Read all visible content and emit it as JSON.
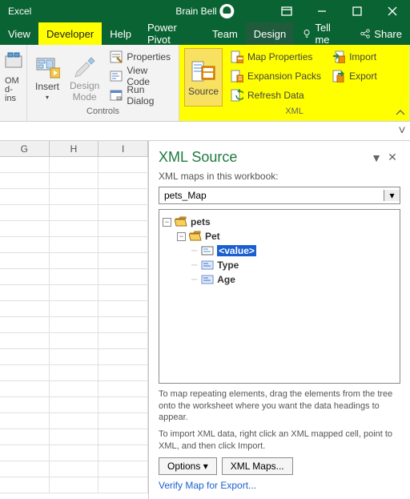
{
  "titlebar": {
    "app_name": "Excel",
    "user_name": "Brain Bell"
  },
  "tabs": {
    "view": "View",
    "developer": "Developer",
    "help": "Help",
    "power_pivot": "Power Pivot",
    "team": "Team",
    "design": "Design",
    "tell_me": "Tell me",
    "share": "Share"
  },
  "ribbon": {
    "addins": {
      "com_label": "OM",
      "d_label": "d-ins"
    },
    "insert": {
      "label": "Insert"
    },
    "design_mode": {
      "label": "Design\nMode"
    },
    "controls_group": "Controls",
    "properties": "Properties",
    "view_code": "View Code",
    "run_dialog": "Run Dialog",
    "source": "Source",
    "map_properties": "Map Properties",
    "expansion_packs": "Expansion Packs",
    "refresh_data": "Refresh Data",
    "import": "Import",
    "export": "Export",
    "xml_group": "XML"
  },
  "sheet": {
    "cols": [
      "G",
      "H",
      "I"
    ]
  },
  "pane": {
    "title": "XML Source",
    "maps_label": "XML maps in this workbook:",
    "selected_map": "pets_Map",
    "tree": {
      "root": "pets",
      "child": "Pet",
      "leaves": [
        "<value>",
        "Type",
        "Age"
      ]
    },
    "hint1": "To map repeating elements, drag the elements from the tree onto the worksheet where you want the data headings to appear.",
    "hint2": "To import XML data, right click an XML mapped cell, point to XML, and then click Import.",
    "options_btn": "Options",
    "xml_maps_btn": "XML Maps...",
    "verify_link": "Verify Map for Export..."
  }
}
